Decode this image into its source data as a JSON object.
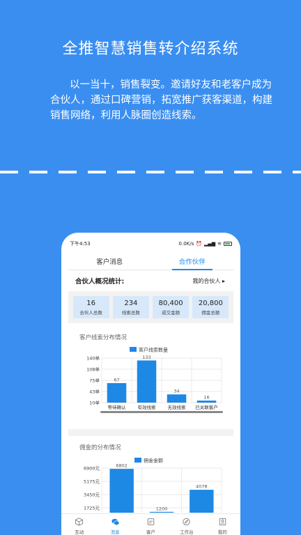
{
  "headline": "全推智慧销售转介绍系统",
  "intro_text": "以一当十，销售裂变。邀请好友和老客户成为合伙人，通过口碑营销，拓宽推广获客渠道，构建销售网络，利用人脉圈创造线索。",
  "status_bar": {
    "time": "下午4:53",
    "network": "0.0K/s"
  },
  "tabs": [
    {
      "label": "客户消息"
    },
    {
      "label": "合作伙伴"
    }
  ],
  "overview": {
    "title": "合伙人概况统计:",
    "link": "我的合伙人 ▸"
  },
  "stats": [
    {
      "value": "16",
      "label": "合伙人总数"
    },
    {
      "value": "234",
      "label": "线索总数"
    },
    {
      "value": "80,400",
      "label": "成交金额"
    },
    {
      "value": "20,800",
      "label": "佣金总额"
    }
  ],
  "chart_leads_title": "客户线索分布情况",
  "chart_commission_title": "佣金的分布情况",
  "chart_data": [
    {
      "type": "bar",
      "legend": "客户线索数量",
      "categories": [
        "等待确认",
        "有效线索",
        "无效线索",
        "已关联客户"
      ],
      "values": [
        67,
        133,
        34,
        16
      ],
      "ytick_labels": [
        "140单",
        "108单",
        "75单",
        "43单",
        "10单"
      ],
      "ylim": [
        10,
        140
      ],
      "grid": true
    },
    {
      "type": "bar",
      "legend": "佣金金额",
      "values": [
        6802,
        1200,
        4078
      ],
      "ytick_labels": [
        "6900元",
        "5175元",
        "3450元",
        "1725元"
      ],
      "ylim": [
        0,
        6900
      ],
      "grid": true
    }
  ],
  "bottom_nav": [
    {
      "label": "互动",
      "icon": "cube-icon"
    },
    {
      "label": "消息",
      "icon": "chat-icon"
    },
    {
      "label": "客户",
      "icon": "customer-icon"
    },
    {
      "label": "工作台",
      "icon": "compass-icon"
    },
    {
      "label": "我的",
      "icon": "profile-icon"
    }
  ],
  "colors": {
    "background": "#3a8ef0",
    "accent": "#1e88e5",
    "bar": "#1e88e5",
    "stat_box": "#d6e8fa"
  }
}
